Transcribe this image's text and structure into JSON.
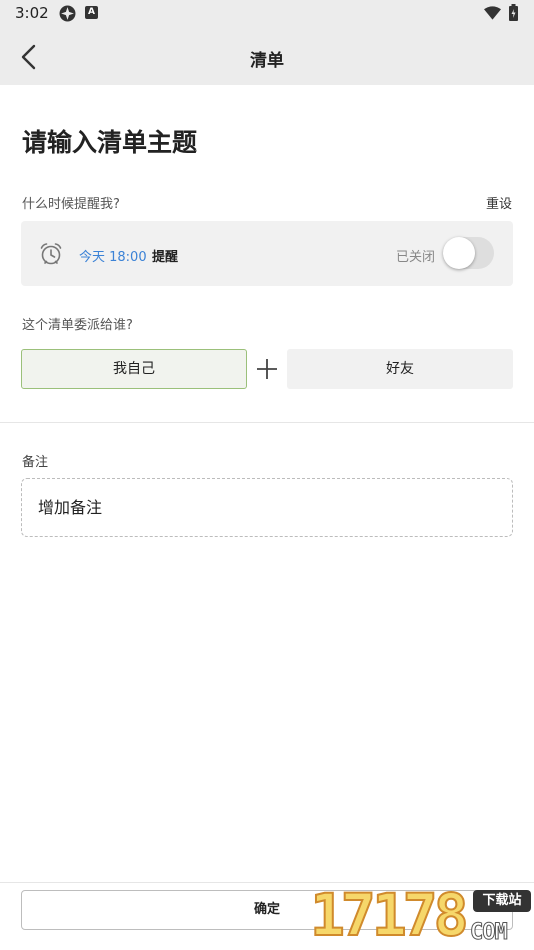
{
  "status_bar": {
    "time": "3:02"
  },
  "app_bar": {
    "title": "清单"
  },
  "topic": {
    "placeholder": "请输入清单主题"
  },
  "reminder": {
    "question": "什么时候提醒我?",
    "reset_label": "重设",
    "time": "今天 18:00",
    "label": "提醒",
    "status": "已关闭",
    "enabled": false
  },
  "assign": {
    "question": "这个清单委派给谁?",
    "self_label": "我自己",
    "friend_label": "好友"
  },
  "note": {
    "label": "备注",
    "placeholder": "增加备注"
  },
  "footer": {
    "confirm_label": "确定"
  },
  "watermark": {
    "digits": "17178",
    "badge": "下载站",
    "domain": "COM"
  },
  "colors": {
    "accent_blue": "#3b82d6",
    "selected_border": "#9bc07a",
    "bar_background": "#ececec"
  }
}
